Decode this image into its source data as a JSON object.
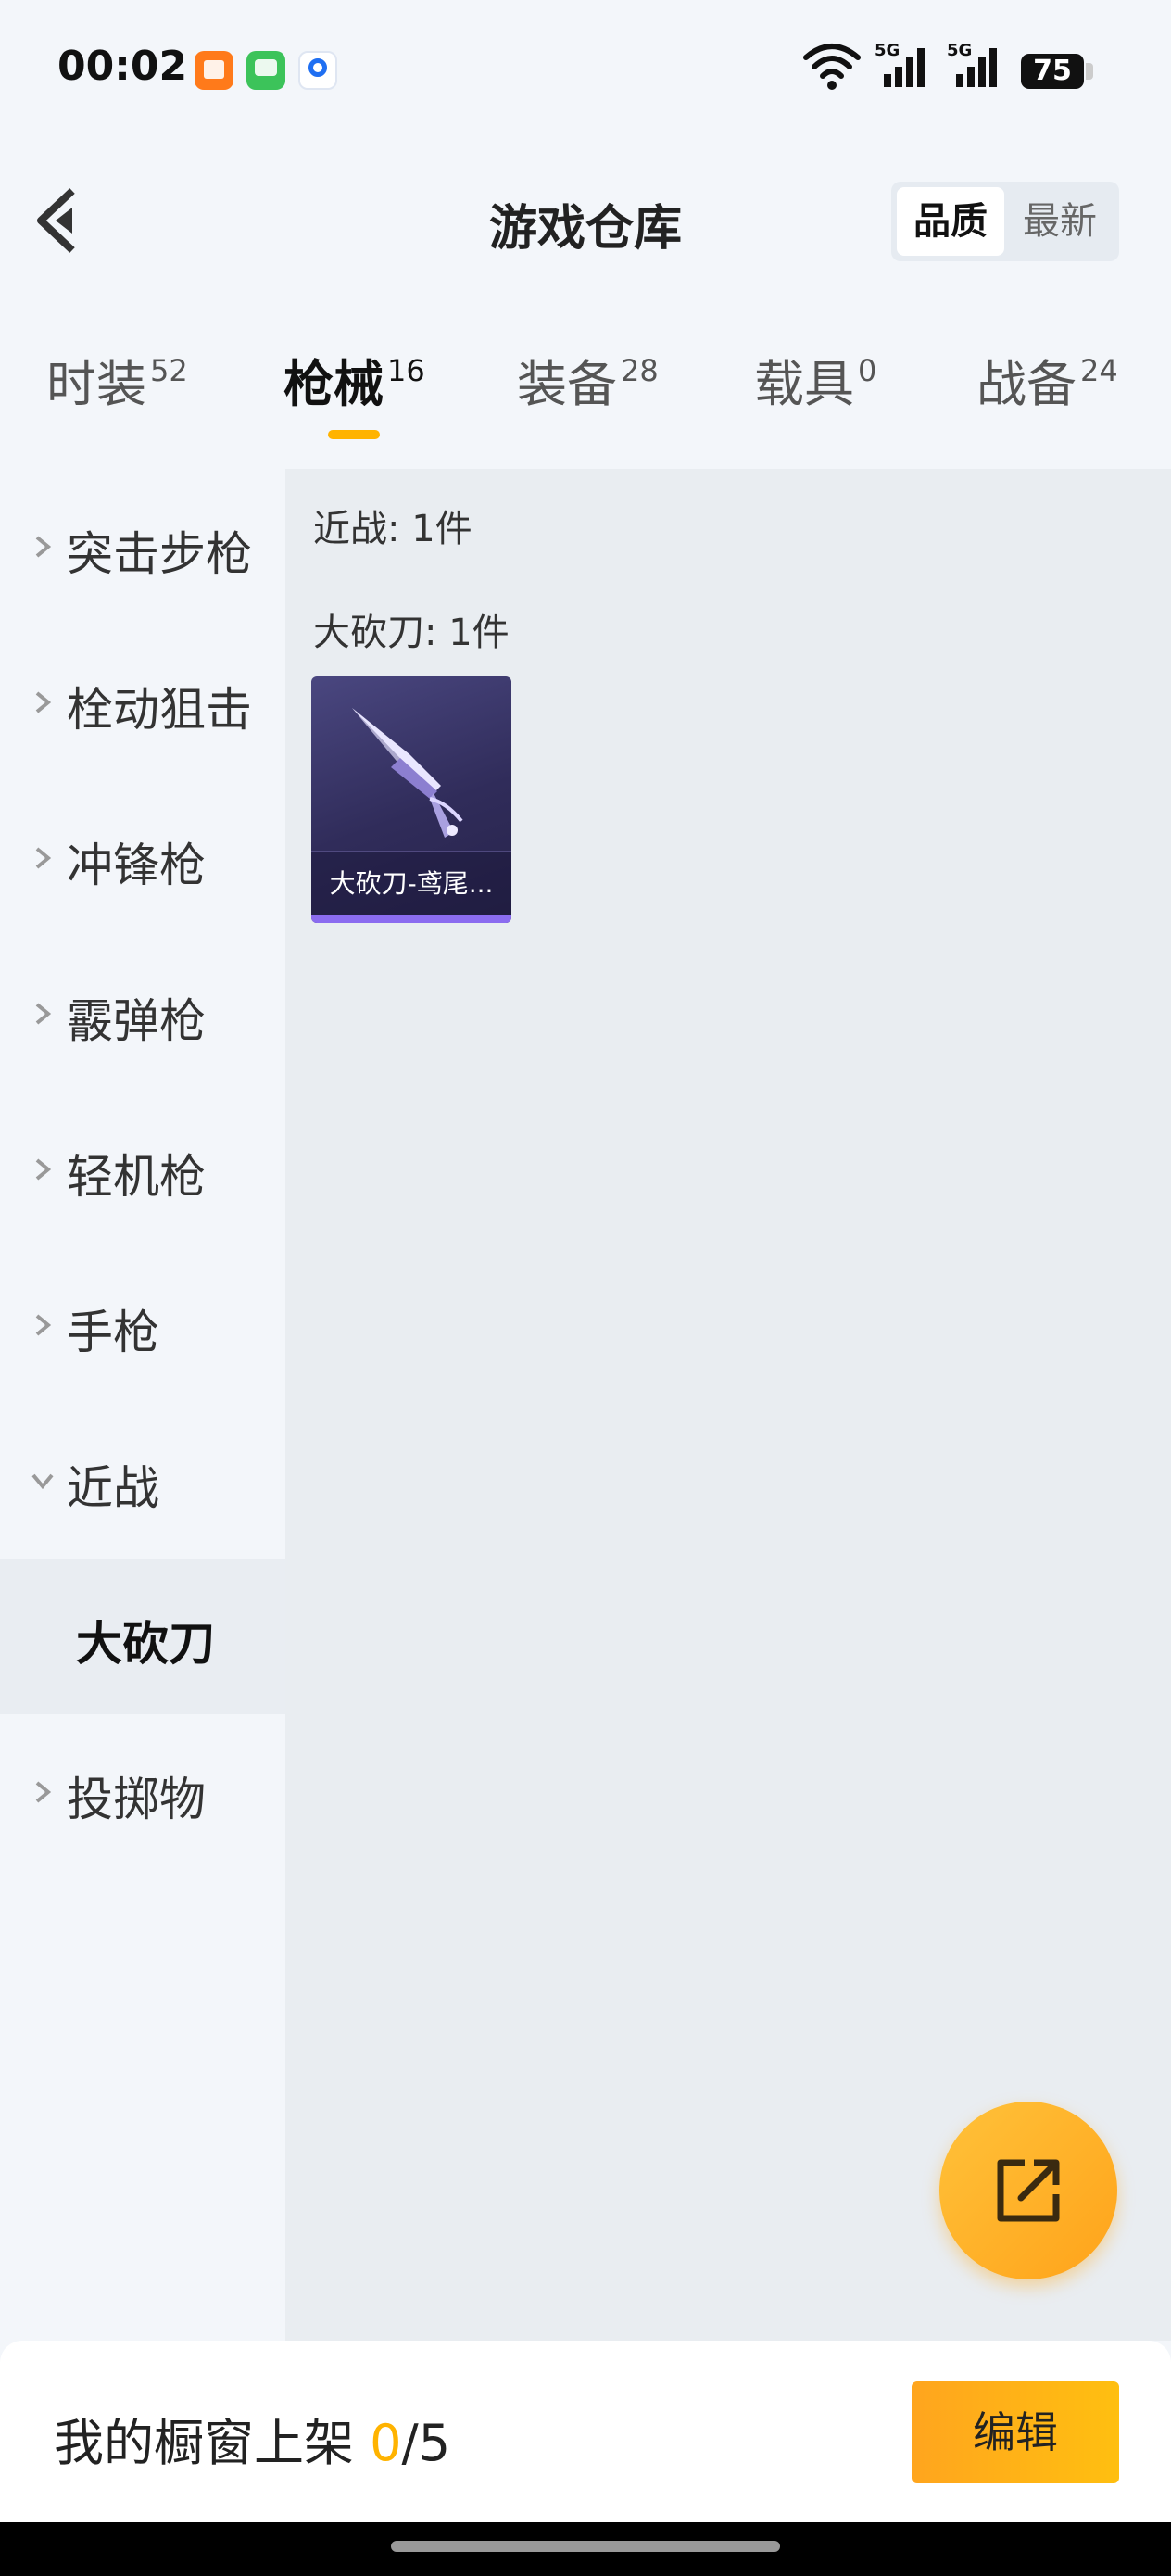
{
  "status_bar": {
    "time": "00:02",
    "battery": "75",
    "network": [
      "5G",
      "5G"
    ]
  },
  "header": {
    "title": "游戏仓库",
    "sort_options": [
      "品质",
      "最新"
    ],
    "sort_selected": "品质"
  },
  "tabs": [
    {
      "label": "时装",
      "count": "52"
    },
    {
      "label": "枪械",
      "count": "16",
      "active": true
    },
    {
      "label": "装备",
      "count": "28"
    },
    {
      "label": "载具",
      "count": "0"
    },
    {
      "label": "战备",
      "count": "24"
    }
  ],
  "sidebar": {
    "items": [
      {
        "label": "突击步枪"
      },
      {
        "label": "栓动狙击"
      },
      {
        "label": "冲锋枪"
      },
      {
        "label": "霰弹枪"
      },
      {
        "label": "轻机枪"
      },
      {
        "label": "手枪"
      },
      {
        "label": "近战",
        "expanded": true
      },
      {
        "label": "投掷物"
      }
    ],
    "selected_sub": "大砍刀"
  },
  "content": {
    "category_summary": "近战: 1件",
    "subcategory_summary": "大砍刀: 1件",
    "items": [
      {
        "name": "大砍刀-鸢尾...",
        "icon": "machete-icon"
      }
    ]
  },
  "fab": {
    "icon": "share-export-icon",
    "color": "#ffb300"
  },
  "bottom_bar": {
    "label": "我的橱窗上架",
    "used": "0",
    "total": "/5",
    "edit_label": "编辑"
  },
  "colors": {
    "accent": "#ffb300",
    "tab_underline": "#ffb300"
  }
}
